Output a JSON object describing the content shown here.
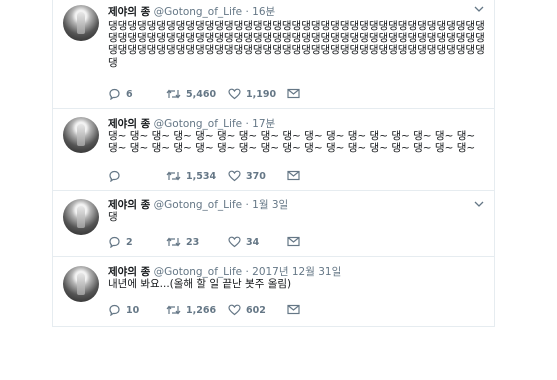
{
  "tweets": [
    {
      "name": "제야의 종",
      "handle": "@Gotong_of_Life",
      "separator": "·",
      "time": "16분",
      "text": "댕댕댕댕댕댕댕댕댕댕댕댕댕댕댕댕댕댕댕댕댕댕댕댕댕댕댕댕댕댕댕댕댕댕댕댕댕댕댕댕댕댕댕댕댕댕댕댕댕댕댕댕댕댕댕댕댕댕댕댕댕댕댕댕댕댕댕댕댕댕댕댕댕댕댕댕댕댕댕댕댕댕댕댕댕댕댕댕댕댕댕댕댕댕댕댕댕댕댕댕댕댕댕댕댕댕댕댕댕댕댕댕댕댕댕댕댕댕",
      "replies": "6",
      "retweets": "5,460",
      "likes": "1,190"
    },
    {
      "name": "제야의 종",
      "handle": "@Gotong_of_Life",
      "separator": "·",
      "time": "17분",
      "text": "댕~ 댕~ 댕~ 댕~ 댕~ 댕~ 댕~ 댕~ 댕~ 댕~ 댕~ 댕~ 댕~ 댕~ 댕~ 댕~ 댕~ 댕~ 댕~ 댕~ 댕~ 댕~ 댕~ 댕~ 댕~ 댕~ 댕~ 댕~ 댕~ 댕~ 댕~ 댕~ 댕~ 댕~",
      "replies": "",
      "retweets": "1,534",
      "likes": "370"
    },
    {
      "name": "제야의 종",
      "handle": "@Gotong_of_Life",
      "separator": "·",
      "time": "1월 3일",
      "text": "댕",
      "replies": "2",
      "retweets": "23",
      "likes": "34"
    },
    {
      "name": "제야의 종",
      "handle": "@Gotong_of_Life",
      "separator": "·",
      "time": "2017년 12월 31일",
      "text": "내년에 봐요...(올해 할 일 끝난 봇주 올림)",
      "replies": "10",
      "retweets": "1,266",
      "likes": "602"
    }
  ],
  "icons": {
    "reply": "reply-icon",
    "retweet": "retweet-icon",
    "like": "heart-icon",
    "dm": "envelope-icon",
    "caret": "chevron-down-icon"
  },
  "colors": {
    "text": "#14171a",
    "muted": "#657786",
    "border": "#e6ecf0"
  }
}
